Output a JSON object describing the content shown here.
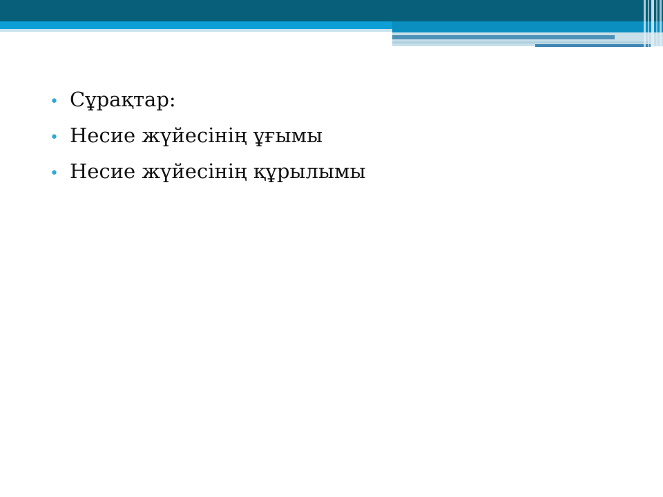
{
  "slide": {
    "colors": {
      "header_dark": "#075f79",
      "header_blue": "#0d9fd6",
      "bullet": "#2fa8d4",
      "text": "#111111",
      "background": "#ffffff"
    },
    "bullet_symbol": "•",
    "bullets": [
      {
        "text": "Сұрақтар:"
      },
      {
        "text": "Несие жүйесінің ұғымы"
      },
      {
        "text": "Несие жүйесінің құрылымы"
      }
    ]
  }
}
